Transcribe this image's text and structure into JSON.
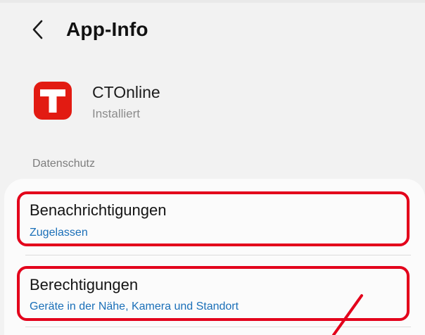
{
  "header": {
    "title": "App-Info",
    "back_icon": "chevron-left-icon"
  },
  "app": {
    "name": "CTOnline",
    "status": "Installiert",
    "icon_letter": "T",
    "icon_color": "#e21b12"
  },
  "section": {
    "label": "Datenschutz"
  },
  "settings": [
    {
      "title": "Benachrichtigungen",
      "subtitle": "Zugelassen"
    },
    {
      "title": "Berechtigungen",
      "subtitle": "Geräte in der Nähe, Kamera und Standort"
    }
  ],
  "colors": {
    "accent_link": "#1a6fb8",
    "annotation_red": "#e3001b",
    "background": "#f2f2f2",
    "card": "#fbfbfb"
  }
}
